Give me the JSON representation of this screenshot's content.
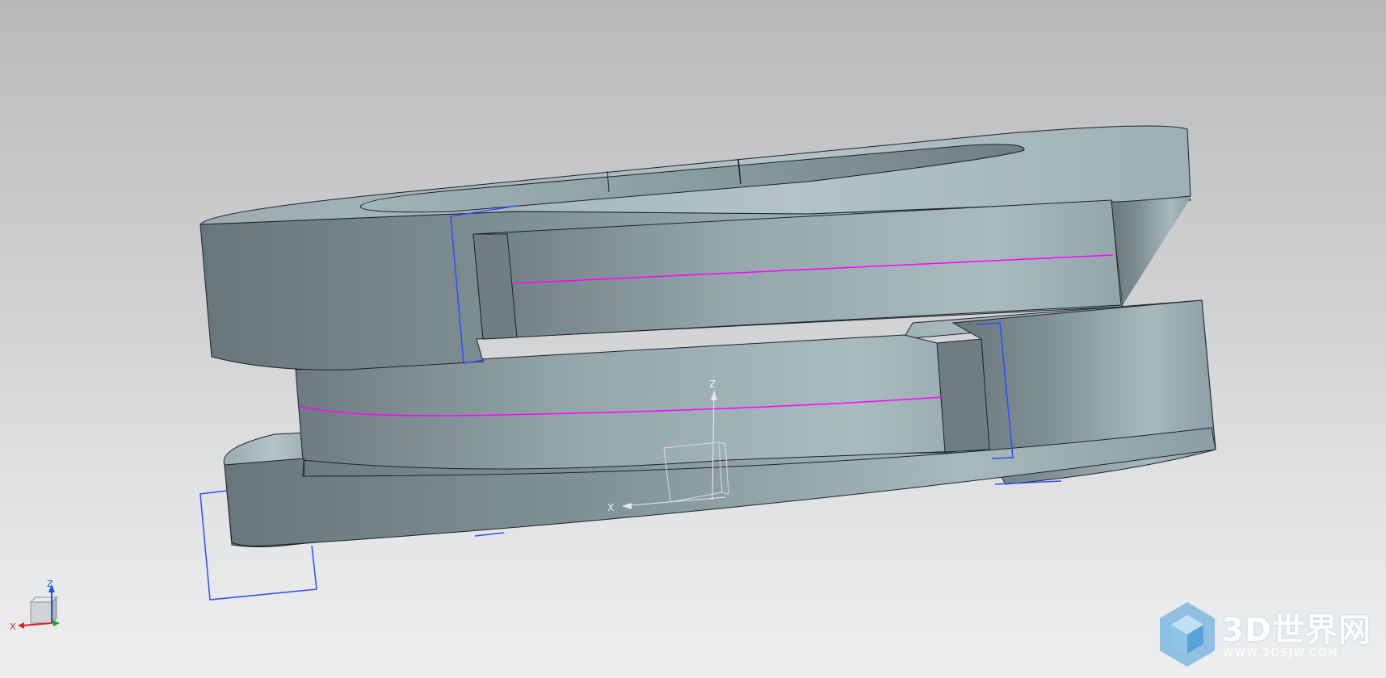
{
  "viewport": {
    "background_top": "#b8babc",
    "background_bottom": "#eceef0",
    "part_color": "#8fa2a8",
    "edge_color": "#1c2226",
    "highlight_curve_color": "#ff00ff",
    "datum_plane_color": "#2f4cff"
  },
  "wcs_triad": {
    "x_label": "X",
    "z_label": "Z"
  },
  "view_triad": {
    "x_label": "X",
    "z_label": "Z",
    "x_color": "#e02020",
    "y_color": "#20a020",
    "z_color": "#2050e0"
  },
  "watermark": {
    "title": "3D世界网",
    "url": "WWW.3DSJW.COM",
    "icon": "cube-hexagon-logo-icon"
  }
}
